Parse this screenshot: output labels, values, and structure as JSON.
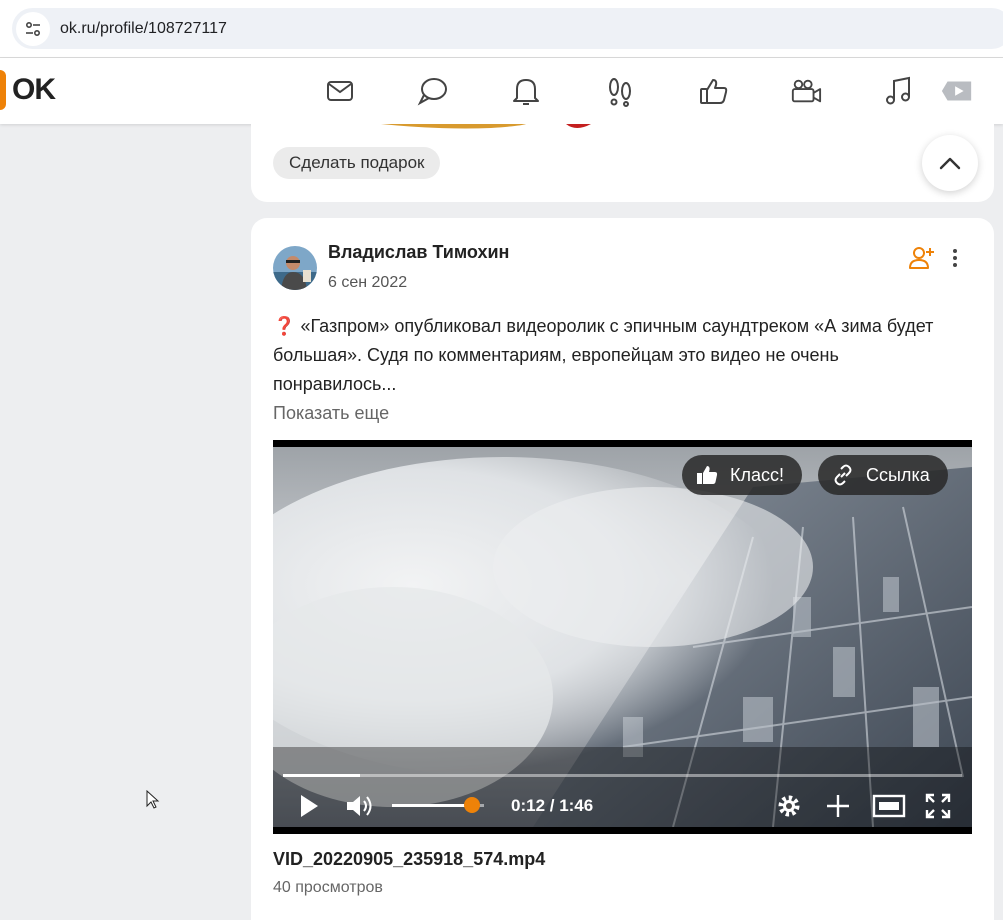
{
  "browser": {
    "url": "ok.ru/profile/108727117"
  },
  "header": {
    "logo_text": "OK",
    "brand_color": "#ee8208",
    "nav_icons": [
      "mail-icon",
      "discussions-icon",
      "notifications-icon",
      "guests-icon",
      "likes-icon",
      "video-icon",
      "music-icon",
      "games-icon"
    ]
  },
  "previous_post": {
    "gift_button": "Сделать подарок"
  },
  "post": {
    "author": "Владислав Тимохин",
    "date": "6 сен 2022",
    "text_mark": "❓",
    "text": "«Газпром» опубликовал видеоролик с эпичным саундтреком «А зима будет большая». Судя по комментариям, европейцам это видео не очень понравилось...",
    "show_more": "Показать еще",
    "video": {
      "like_button": "Класс!",
      "link_button": "Ссылка",
      "time": "0:12 / 1:46",
      "progress": 0.113,
      "volume": 0.87
    },
    "file_name": "VID_20220905_235918_574.mp4",
    "views": "40 просмотров"
  }
}
